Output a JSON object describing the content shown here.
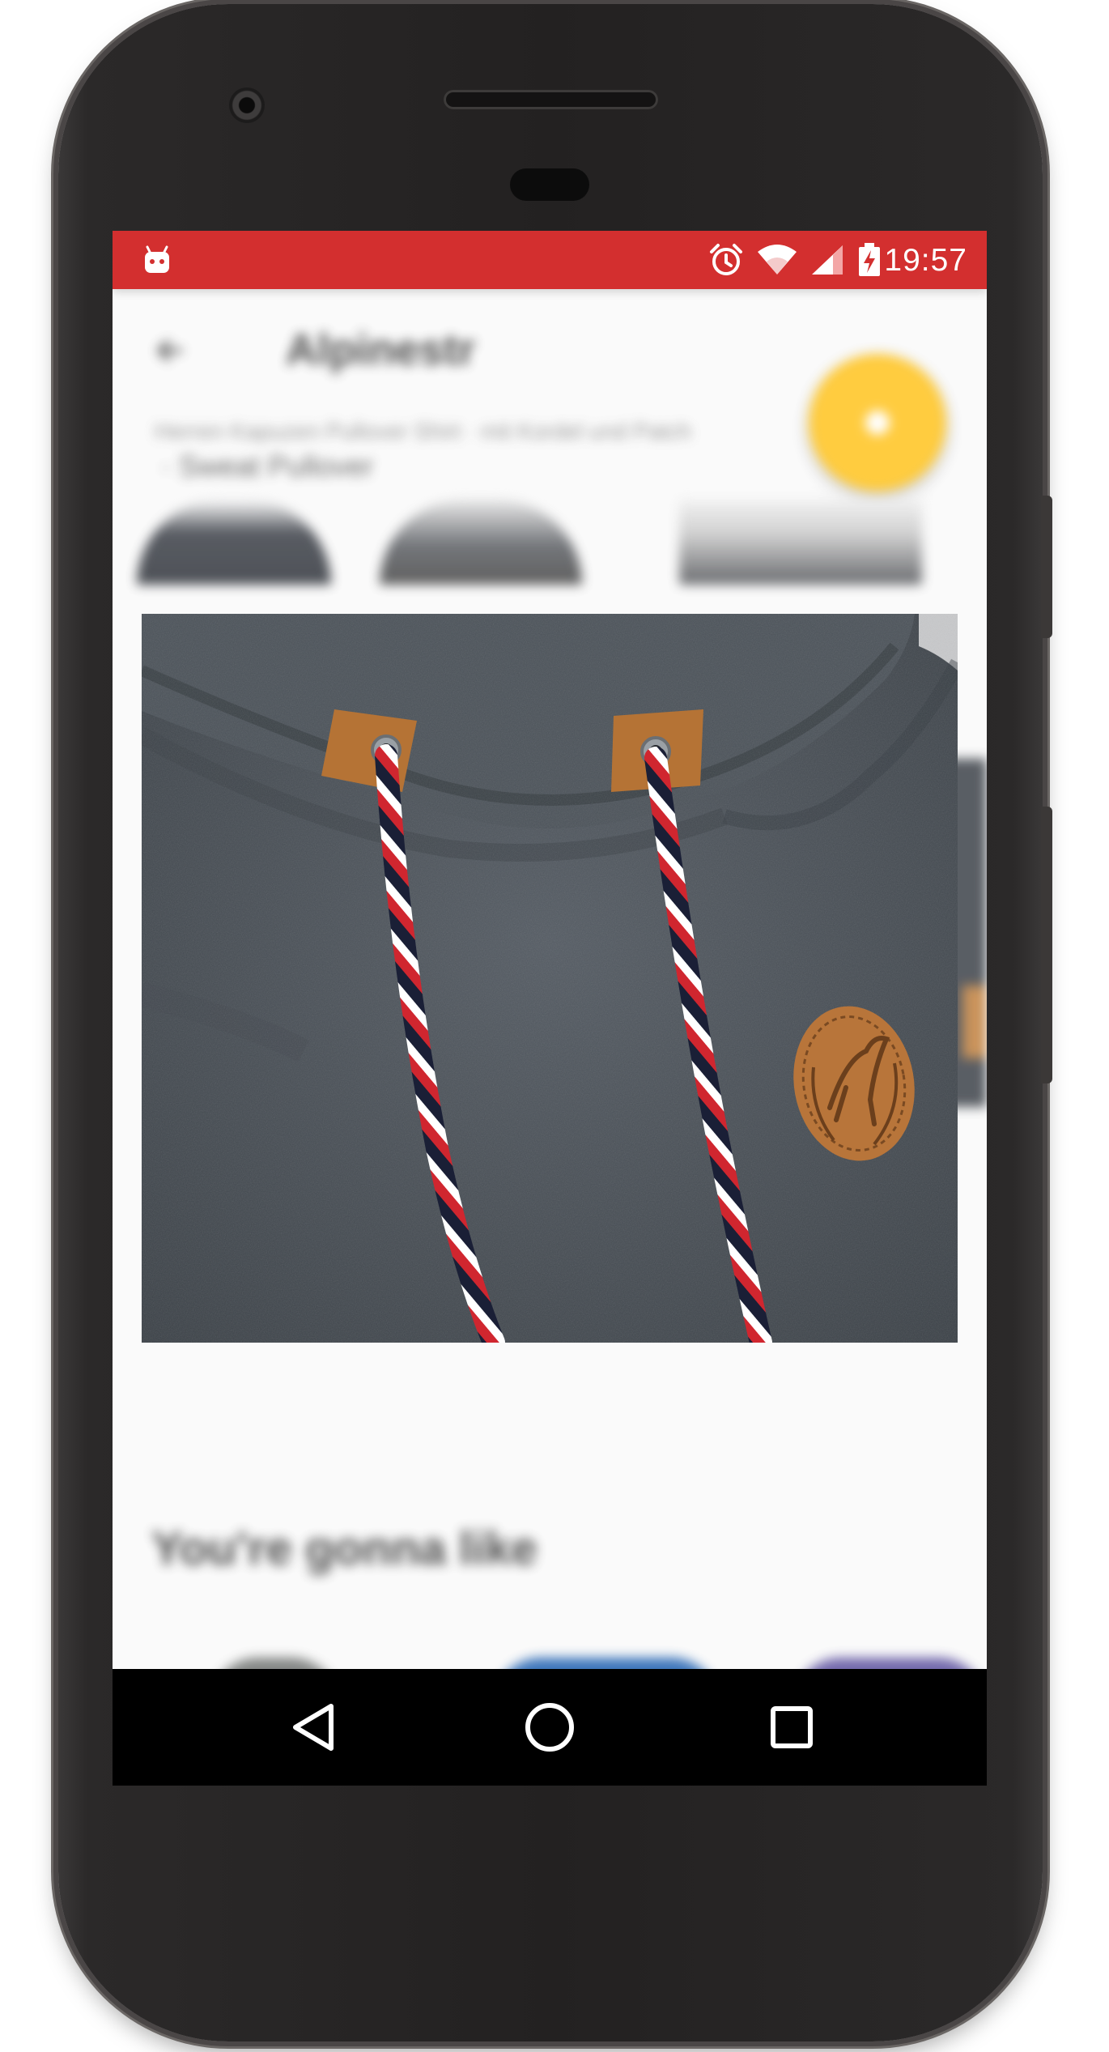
{
  "device": {
    "name": "Android phone"
  },
  "status_bar": {
    "time": "19:57",
    "color": "#d32f2f",
    "icons": [
      "android-notification-icon",
      "alarm-icon",
      "wifi-icon",
      "signal-icon",
      "battery-charging-icon"
    ]
  },
  "background_app": {
    "app_bar_title": "Alpinestr",
    "subtitle_line1": "Herren Kapuzen Pullover Shirt · mit Kordel und Patch",
    "subtitle_line2": "· Sweat Pullover",
    "section_title": "You're gonna like",
    "fab_color": "#ffc31d",
    "fab_icon": "star-icon"
  },
  "expanded_image": {
    "description_name": "hoodie-detail-photo",
    "accent_colors": [
      "#4a5158",
      "#d0262f",
      "#ffffff",
      "#1a1f36",
      "#b57335"
    ]
  },
  "nav_bar": {
    "buttons": [
      "back",
      "home",
      "recents"
    ]
  }
}
